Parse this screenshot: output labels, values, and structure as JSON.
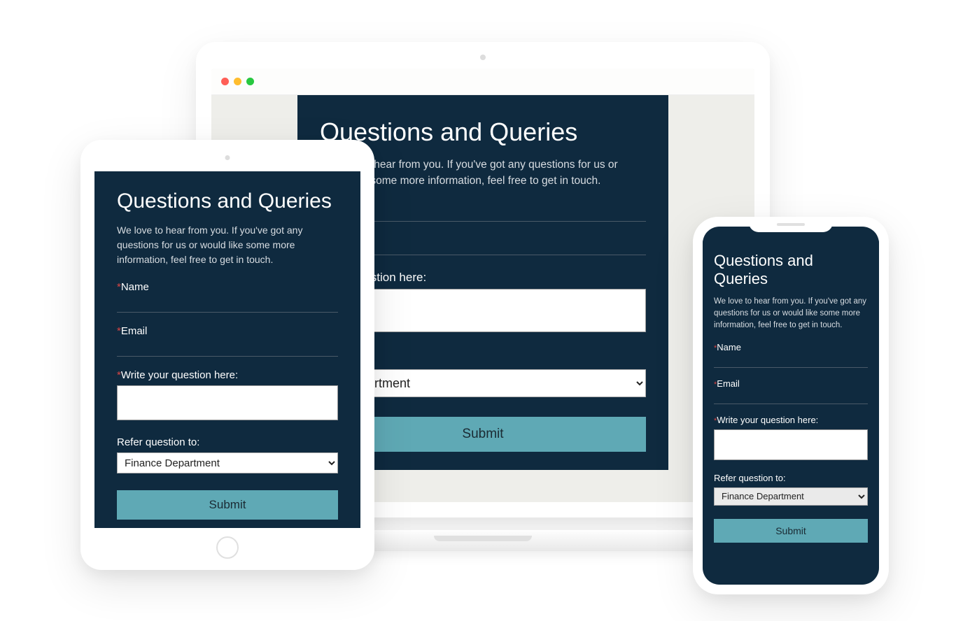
{
  "form": {
    "title": "Questions and Queries",
    "description": "We love to hear from you. If you've got any questions for us or would like some more information, feel free to get in touch.",
    "name_label": "Name",
    "email_label": "Email",
    "question_label": "Write your question here:",
    "refer_label": "Refer question to:",
    "refer_value": "Finance Department",
    "submit_label": "Submit",
    "required_mark": "*"
  },
  "laptop": {
    "question_label_partial": "your question here:",
    "refer_label_partial": "uestion to:",
    "refer_value_partial": "ce Department"
  }
}
